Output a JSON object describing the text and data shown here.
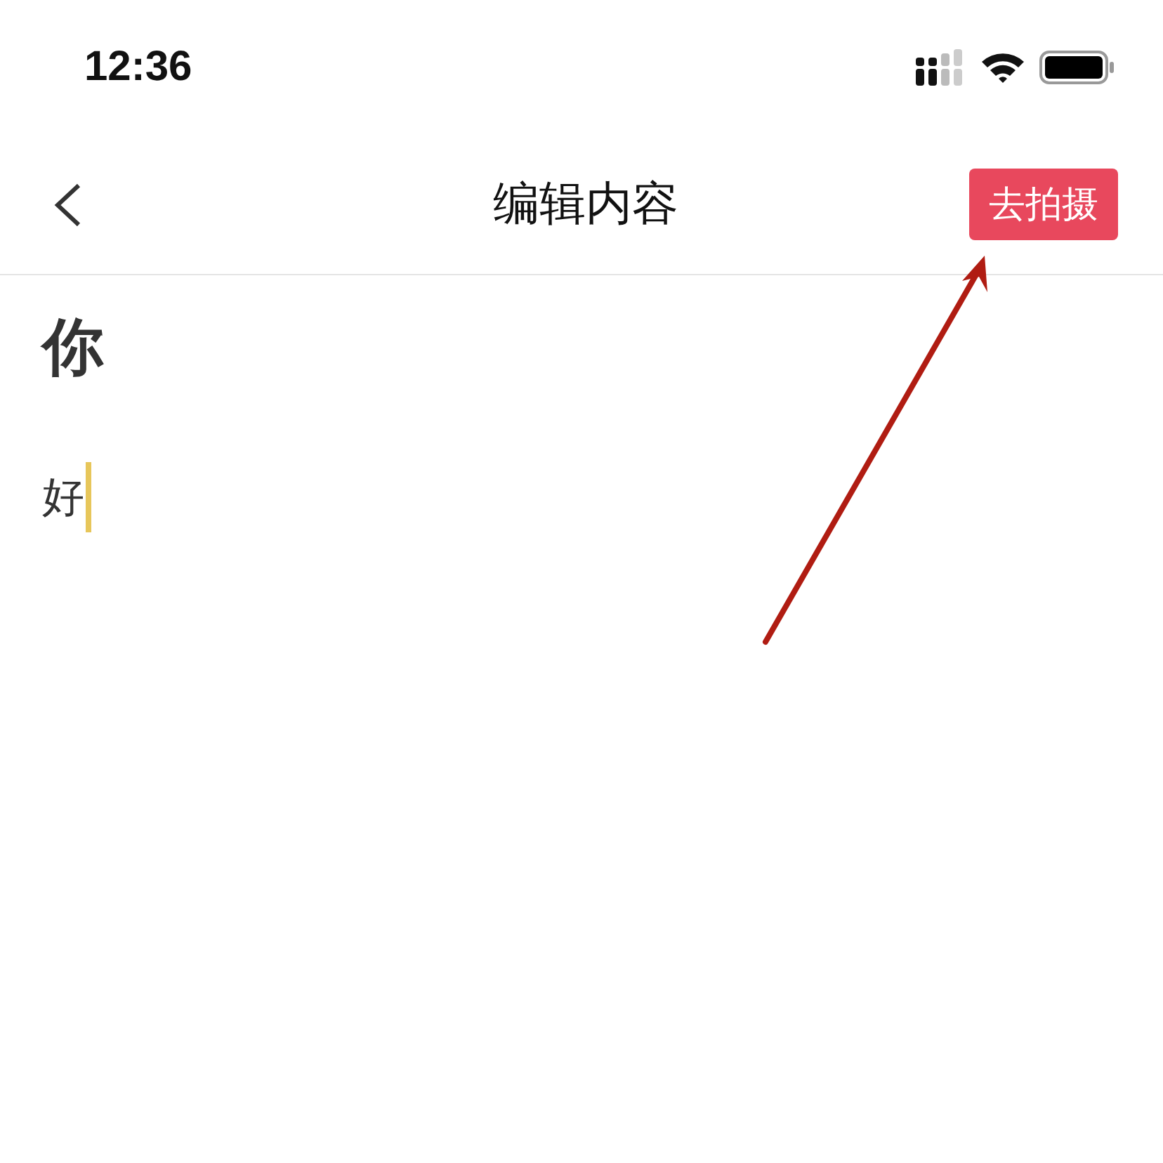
{
  "status_bar": {
    "time": "12:36"
  },
  "nav_bar": {
    "title": "编辑内容",
    "action_button": "去拍摄"
  },
  "editor": {
    "title": "你",
    "body": "好",
    "body_focused": true
  },
  "annotation": {
    "kind": "arrow",
    "color": "#b01c12"
  }
}
